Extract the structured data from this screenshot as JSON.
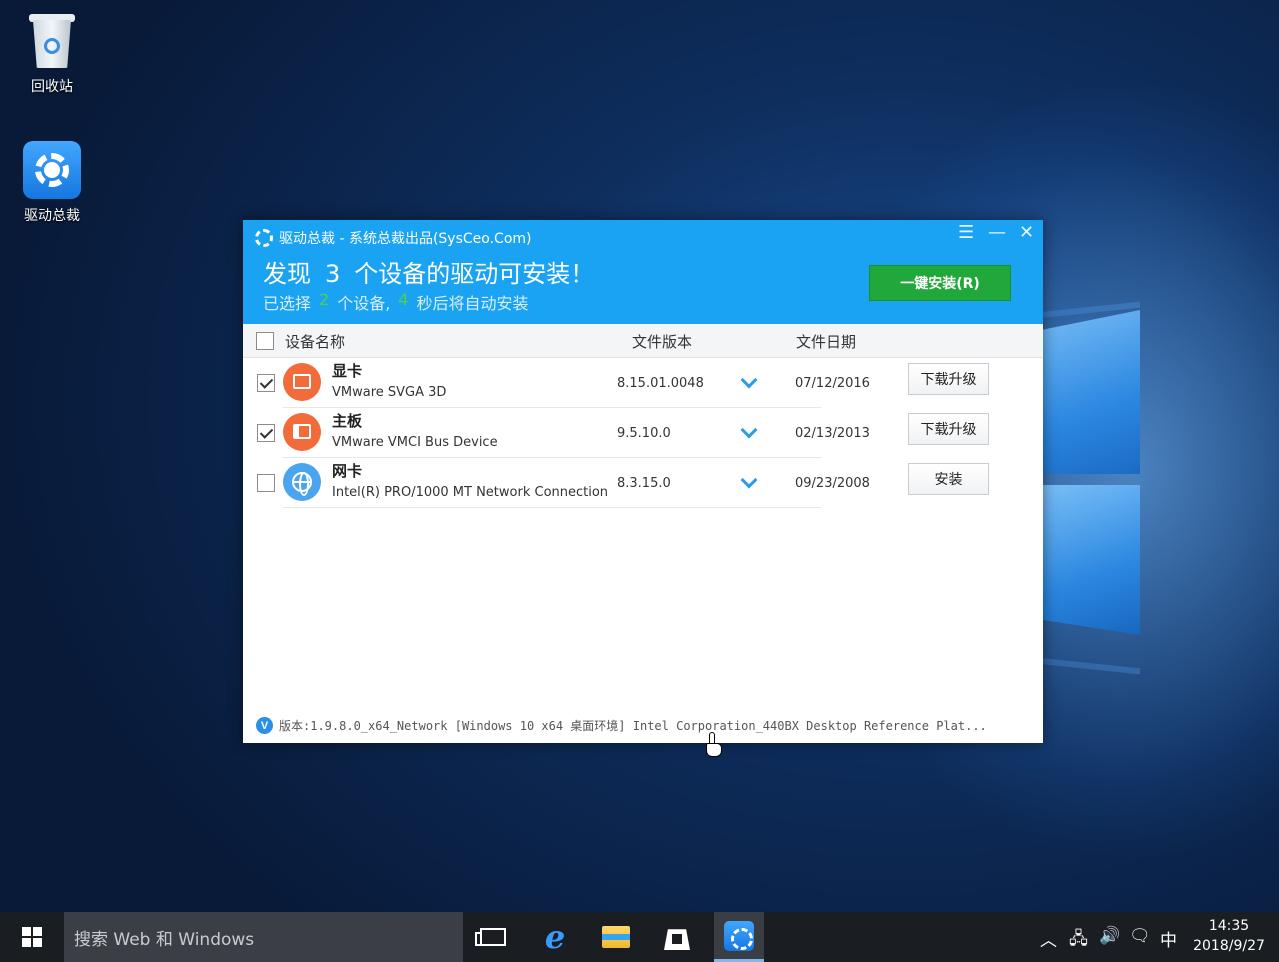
{
  "desktop": {
    "icons": [
      {
        "label": "回收站"
      },
      {
        "label": "驱动总裁"
      }
    ]
  },
  "app": {
    "title": "驱动总裁 - 系统总裁出品(SysCeo.Com)",
    "found_prefix": "发现",
    "found_count": "3",
    "found_suffix": "个设备的驱动可安装！",
    "selected_prefix": "已选择",
    "selected_count": "2",
    "selected_middle": "个设备,",
    "countdown": "4",
    "countdown_suffix": "秒后将自动安装",
    "install_all_label": "一键安装(R)",
    "columns": {
      "name": "设备名称",
      "version": "文件版本",
      "date": "文件日期"
    },
    "devices": [
      {
        "name": "显卡",
        "model": "VMware SVGA 3D",
        "version": "8.15.01.0048",
        "date": "07/12/2016",
        "action": "下载升级",
        "checked": true,
        "icon": "display-icon",
        "icon_color": "#f26b3a"
      },
      {
        "name": "主板",
        "model": "VMware VMCI Bus Device",
        "version": "9.5.10.0",
        "date": "02/13/2013",
        "action": "下载升级",
        "checked": true,
        "icon": "motherboard-icon",
        "icon_color": "#f26b3a"
      },
      {
        "name": "网卡",
        "model": "Intel(R) PRO/1000 MT Network Connection",
        "version": "8.3.15.0",
        "date": "09/23/2008",
        "action": "安装",
        "checked": false,
        "icon": "globe-icon",
        "icon_color": "#4ba4ee"
      }
    ],
    "footer_badge": "V",
    "footer": "版本:1.9.8.0_x64_Network [Windows 10 x64 桌面环境] Intel Corporation_440BX Desktop Reference Plat...",
    "header_color": "#1aa3f2",
    "install_color": "#21a83a"
  },
  "taskbar": {
    "search_placeholder": "搜索 Web 和 Windows",
    "ime": "中",
    "time": "14:35",
    "date": "2018/9/27"
  }
}
